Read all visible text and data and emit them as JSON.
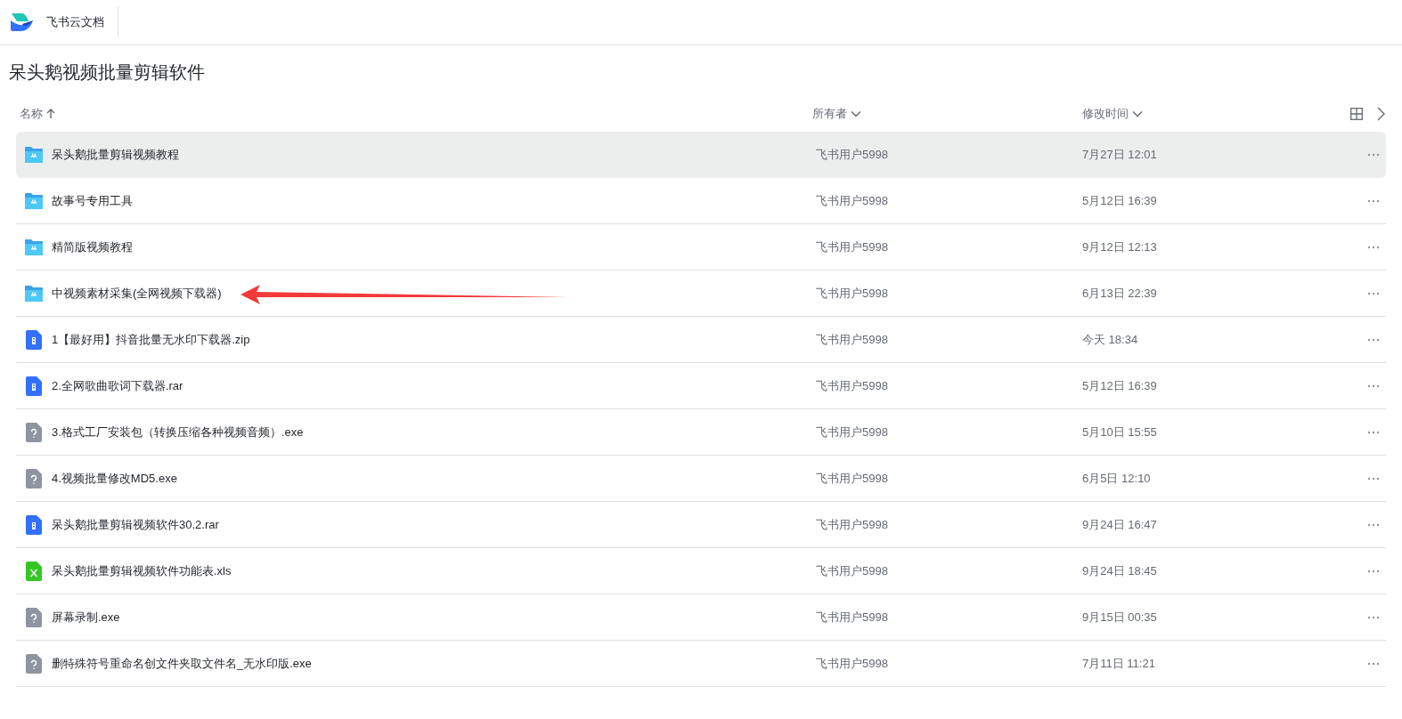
{
  "app": {
    "name": "飞书云文档"
  },
  "folder_title": "呆头鹅视频批量剪辑软件",
  "columns": [
    {
      "label": "名称",
      "kind": "sorted"
    },
    {
      "label": "所有者",
      "kind": "dropdown"
    },
    {
      "label": "修改时间",
      "kind": "dropdown"
    }
  ],
  "rows": [
    {
      "kind": "folder",
      "name": "呆头鹅批量剪辑视频教程",
      "owner": "飞书用户5998",
      "modified": "7月27日 12:01",
      "selected": true
    },
    {
      "kind": "folder",
      "name": "故事号专用工具",
      "owner": "飞书用户5998",
      "modified": "5月12日 16:39",
      "selected": false
    },
    {
      "kind": "folder",
      "name": "精简版视频教程",
      "owner": "飞书用户5998",
      "modified": "9月12日 12:13",
      "selected": false
    },
    {
      "kind": "folder",
      "name": "中视频素材采集(全网视频下载器)",
      "owner": "飞书用户5998",
      "modified": "6月13日 22:39",
      "selected": false
    },
    {
      "kind": "archive",
      "name": "1【最好用】抖音批量无水印下载器.zip",
      "owner": "飞书用户5998",
      "modified": "今天 18:34",
      "selected": false
    },
    {
      "kind": "archive",
      "name": "2.全网歌曲歌词下载器.rar",
      "owner": "飞书用户5998",
      "modified": "5月12日 16:39",
      "selected": false
    },
    {
      "kind": "unknown",
      "name": "3.格式工厂安装包（转换压缩各种视频音频）.exe",
      "owner": "飞书用户5998",
      "modified": "5月10日 15:55",
      "selected": false
    },
    {
      "kind": "unknown",
      "name": "4.视频批量修改MD5.exe",
      "owner": "飞书用户5998",
      "modified": "6月5日 12:10",
      "selected": false
    },
    {
      "kind": "archive",
      "name": "呆头鹅批量剪辑视频软件30.2.rar",
      "owner": "飞书用户5998",
      "modified": "9月24日 16:47",
      "selected": false
    },
    {
      "kind": "sheet",
      "name": "呆头鹅批量剪辑视频软件功能表.xls",
      "owner": "飞书用户5998",
      "modified": "9月24日 18:45",
      "selected": false
    },
    {
      "kind": "unknown",
      "name": "屏幕录制.exe",
      "owner": "飞书用户5998",
      "modified": "9月15日 00:35",
      "selected": false
    },
    {
      "kind": "unknown",
      "name": "删特殊符号重命名创文件夹取文件名_无水印版.exe",
      "owner": "飞书用户5998",
      "modified": "7月11日 11:21",
      "selected": false
    }
  ]
}
